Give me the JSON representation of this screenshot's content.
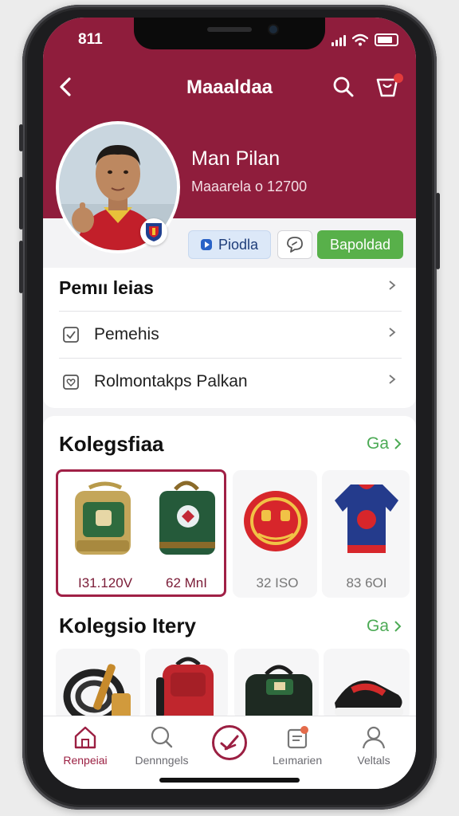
{
  "status_bar": {
    "time": "811"
  },
  "header": {
    "title": "Maaaldaa"
  },
  "profile": {
    "name": "Man Pilan",
    "subtitle": "Maaarela o 12700",
    "actions": {
      "primary": "Piodla",
      "secondary": "Bapoldad"
    }
  },
  "menu": {
    "heading": "Pemıı leias",
    "items": [
      {
        "label": "Pemehis",
        "icon": "checkbox-icon"
      },
      {
        "label": "Rolmontakps Palkan",
        "icon": "heart-note-icon"
      }
    ]
  },
  "collections": {
    "title": "Kolegsfiaa",
    "link": "Ga",
    "items": [
      {
        "name": "green-backpack",
        "price": "I31.120V"
      },
      {
        "name": "green-bag",
        "price": "62 MnI"
      },
      {
        "name": "red-ball-bag",
        "price": "32 ISO"
      },
      {
        "name": "blue-jersey",
        "price": "83 6OI"
      }
    ]
  },
  "collections2": {
    "title": "Kolegsio Itery",
    "link": "Ga",
    "items": [
      {
        "name": "coiled-hose"
      },
      {
        "name": "red-backpack"
      },
      {
        "name": "green-duffel"
      },
      {
        "name": "red-sneaker"
      }
    ]
  },
  "tab_bar": {
    "items": [
      {
        "label": "Renpeiai",
        "icon": "home-icon",
        "active": true
      },
      {
        "label": "Dennngels",
        "icon": "search-icon",
        "active": false
      },
      {
        "label": "",
        "icon": "center-action-icon",
        "active": false
      },
      {
        "label": "Leımarien",
        "icon": "inbox-icon",
        "active": false
      },
      {
        "label": "Veltals",
        "icon": "user-icon",
        "active": false
      }
    ]
  },
  "colors": {
    "brand": "#8f1d3c",
    "accent_green": "#58b04a",
    "link_green": "#4caa55"
  }
}
